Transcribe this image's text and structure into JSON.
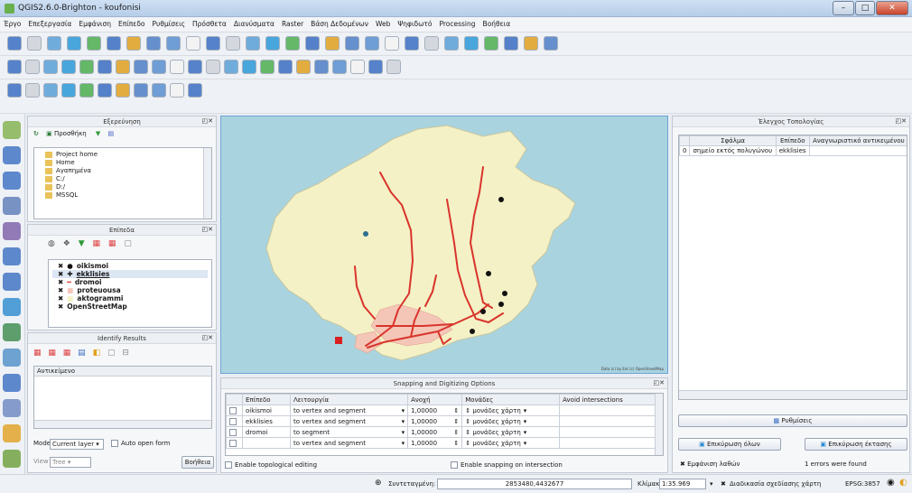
{
  "window": {
    "title": "QGIS2.6.0-Brighton - koufonisi"
  },
  "menu": [
    "Έργο",
    "Επεξεργασία",
    "Εμφάνιση",
    "Επίπεδο",
    "Ρυθμίσεις",
    "Πρόσθετα",
    "Διανύσματα",
    "Raster",
    "Βάση Δεδομένων",
    "Web",
    "Ψηφιδωτό",
    "Processing",
    "Βοήθεια"
  ],
  "browser": {
    "title": "Εξερεύνηση",
    "add_label": "Προσθήκη",
    "items": [
      "Project home",
      "Home",
      "Αγαπημένα",
      "C:/",
      "D:/",
      "MSSQL"
    ]
  },
  "layers": {
    "title": "Επίπεδα",
    "items": [
      "oikismoi",
      "ekklisies",
      "dromoi",
      "proteuousa",
      "aktogrammi",
      "OpenStreetMap"
    ],
    "colors": {
      "road": "#d9342b",
      "area": "#f4c6b8",
      "sea": "#a9d3de",
      "land": "#f4f1c6"
    }
  },
  "identify": {
    "title": "Identify Results",
    "header": "Αντικείμενο",
    "mode_label": "Mode",
    "mode_value": "Current layer",
    "auto_open": "Auto open form",
    "view_label": "View",
    "view_value": "Tree",
    "help": "Βοήθεια"
  },
  "map": {
    "attribution": "Data (c) by Ext (c) OpenStreetMap"
  },
  "snapping": {
    "title": "Snapping and Digitizing Options",
    "headers": [
      "Επίπεδο",
      "Λειτουργία",
      "Ανοχή",
      "Μονάδες",
      "Avoid intersections"
    ],
    "rows": [
      [
        "oikismoi",
        "to vertex and segment",
        "1,00000",
        "μονάδες χάρτη"
      ],
      [
        "ekklisies",
        "to vertex and segment",
        "1,00000",
        "μονάδες χάρτη"
      ],
      [
        "dromoi",
        "to segment",
        "1,00000",
        "μονάδες χάρτη"
      ],
      [
        "",
        "to vertex and segment",
        "1,00000",
        "μονάδες χάρτη"
      ]
    ],
    "topo_edit": "Enable topological editing",
    "snap_inter": "Enable snapping on intersection"
  },
  "topology": {
    "title": "Έλεγχος Τοπολογίας",
    "headers": [
      "Σφάλμα",
      "Επίπεδο",
      "Αναγνωριστικό αντικειμένου"
    ],
    "rows": [
      {
        "n": "0",
        "error": "σημείο εκτός πολυγώνου",
        "layer": "ekklisies",
        "id": ""
      }
    ],
    "settings": "Ρυθμίσεις",
    "validate_all": "Επικύρωση όλων",
    "validate_extent": "Επικύρωση έκτασης",
    "show_errors": "Εμφάνιση λαθών",
    "errors_found": "1 errors were found"
  },
  "status": {
    "coord_label": "Συντεταγμένη:",
    "coord": "2853480,4432677",
    "scale_label": "Κλίμακα",
    "scale": "1:35.969",
    "render": "Διαδικασία σχεδίασης χάρτη",
    "epsg": "EPSG:3857"
  }
}
